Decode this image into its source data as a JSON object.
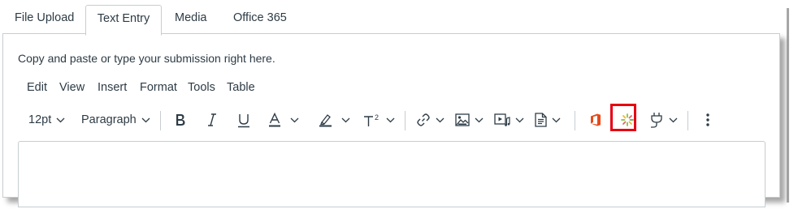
{
  "tabs": [
    {
      "label": "File Upload"
    },
    {
      "label": "Text Entry",
      "active": true
    },
    {
      "label": "Media"
    },
    {
      "label": "Office 365"
    }
  ],
  "instructions": "Copy and paste or type your submission right here.",
  "menubar": [
    "Edit",
    "View",
    "Insert",
    "Format",
    "Tools",
    "Table"
  ],
  "toolbar": {
    "font_size": "12pt",
    "block_format": "Paragraph",
    "icons": [
      "bold-icon",
      "italic-icon",
      "underline-icon",
      "text-color-icon",
      "highlight-icon",
      "superscript-icon",
      "link-icon",
      "image-icon",
      "media-icon",
      "document-icon",
      "office-365-icon",
      "apps-burst-icon",
      "plug-icon",
      "more-options-icon"
    ]
  },
  "colors": {
    "text": "#2d3b45",
    "border": "#c7cdd1",
    "office_orange": "#e64a19",
    "highlight_red": "#e60012",
    "burst_green": "#8cbf3f"
  }
}
